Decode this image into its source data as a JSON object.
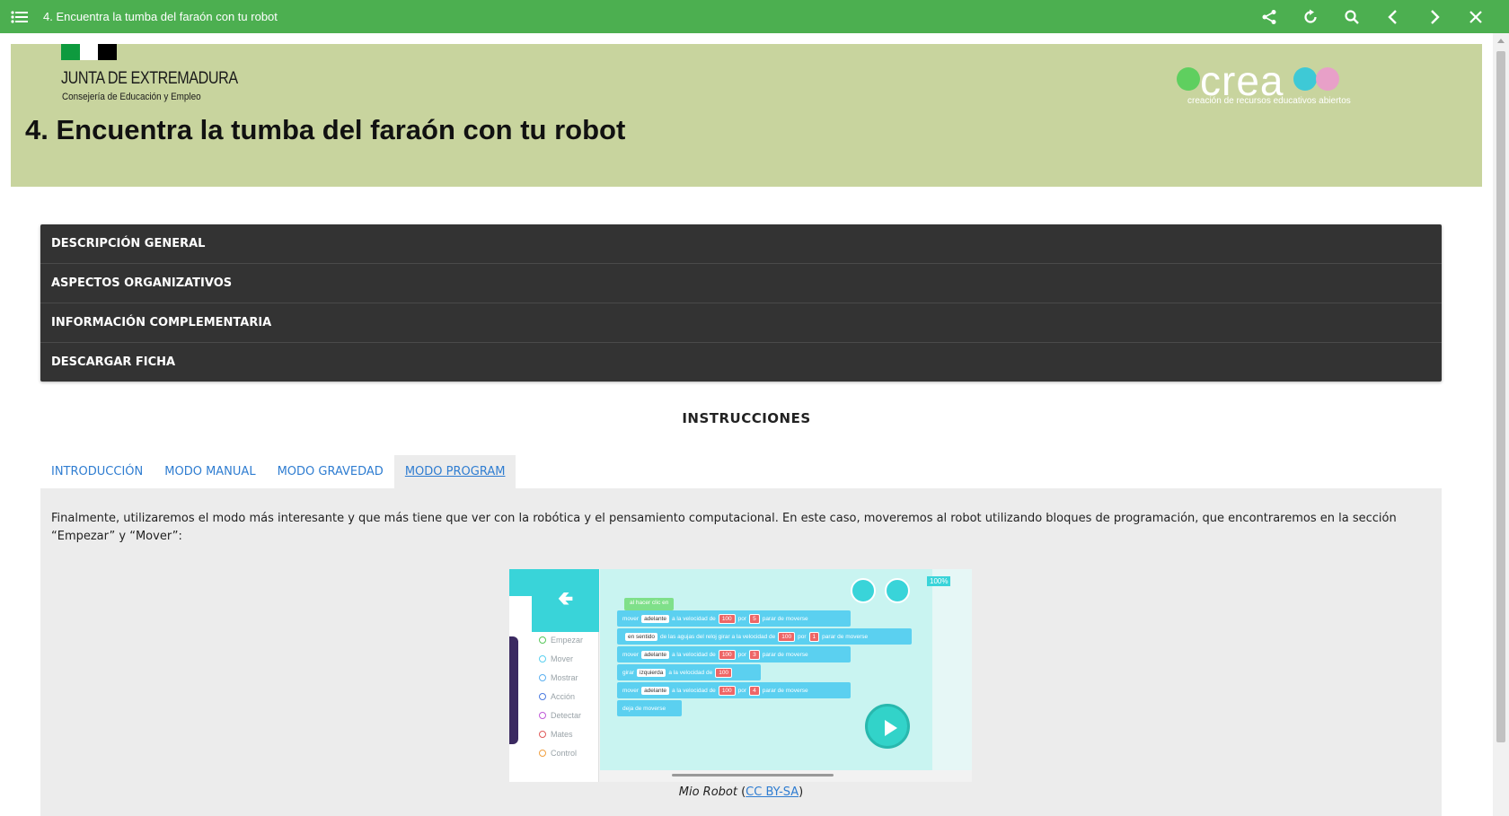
{
  "topbar": {
    "title": "4. Encuentra la tumba del faraón con tu robot",
    "icons": [
      "menu-icon",
      "share-icon",
      "reload-icon",
      "search-icon",
      "chevron-left-icon",
      "chevron-right-icon",
      "close-icon"
    ]
  },
  "banner": {
    "org_name": "JUNTA DE EXTREMADURA",
    "org_sub": "Consejería de Educación y Empleo",
    "title": "4. Encuentra la tumba del faraón con tu robot",
    "crea_word": "crea",
    "crea_tagline": "creación de recursos educativos abiertos",
    "colors": {
      "banner_bg": "#c8d49e",
      "flag_green": "#0e9a3e",
      "flag_white": "#ffffff",
      "flag_black": "#000000"
    }
  },
  "accordion": {
    "items": [
      "DESCRIPCIÓN GENERAL",
      "ASPECTOS ORGANIZATIVOS",
      "INFORMACIÓN COMPLEMENTARIA",
      "DESCARGAR FICHA"
    ]
  },
  "instructions": {
    "heading": "INSTRUCCIONES",
    "tabs": [
      "INTRODUCCIÓN",
      "MODO MANUAL",
      "MODO GRAVEDAD",
      "MODO PROGRAM"
    ],
    "active_tab": "MODO PROGRAM",
    "paragraph": "Finalmente, utilizaremos el modo más interesante y que más tiene que ver con la robótica y el pensamiento computacional. En este caso, moveremos al robot utilizando bloques de programación, que encontraremos en la sección “Empezar” y “Mover”:",
    "caption_title": "Mio Robot",
    "caption_open": " (",
    "caption_link": "CC BY-SA",
    "caption_close": ")"
  },
  "robot_app": {
    "zoom": "100%",
    "categories": [
      "Empezar",
      "Mover",
      "Mostrar",
      "Acción",
      "Detectar",
      "Mates",
      "Control"
    ],
    "start_block": "al hacer clic en",
    "blocks": [
      {
        "pre": "mover",
        "word": "adelante",
        "mid": "a la velocidad de",
        "n1": "100",
        "por": "por",
        "n2": "5",
        "post": "parar de moverse"
      },
      {
        "pre": "",
        "word": "en sentido",
        "mid": "de las agujas del reloj   girar a la velocidad de",
        "n1": "100",
        "por": "por",
        "n2": "1",
        "post": "parar de moverse"
      },
      {
        "pre": "mover",
        "word": "adelante",
        "mid": "a la velocidad de",
        "n1": "100",
        "por": "por",
        "n2": "3",
        "post": "parar de moverse"
      },
      {
        "pre": "girar",
        "word": "izquierda",
        "mid": "a la velocidad de",
        "n1": "100",
        "por": "",
        "n2": "",
        "post": ""
      },
      {
        "pre": "mover",
        "word": "adelante",
        "mid": "a la velocidad de",
        "n1": "100",
        "por": "por",
        "n2": "4",
        "post": "parar de moverse"
      },
      {
        "pre": "deja de moverse",
        "word": "",
        "mid": "",
        "n1": "",
        "por": "",
        "n2": "",
        "post": ""
      }
    ]
  }
}
